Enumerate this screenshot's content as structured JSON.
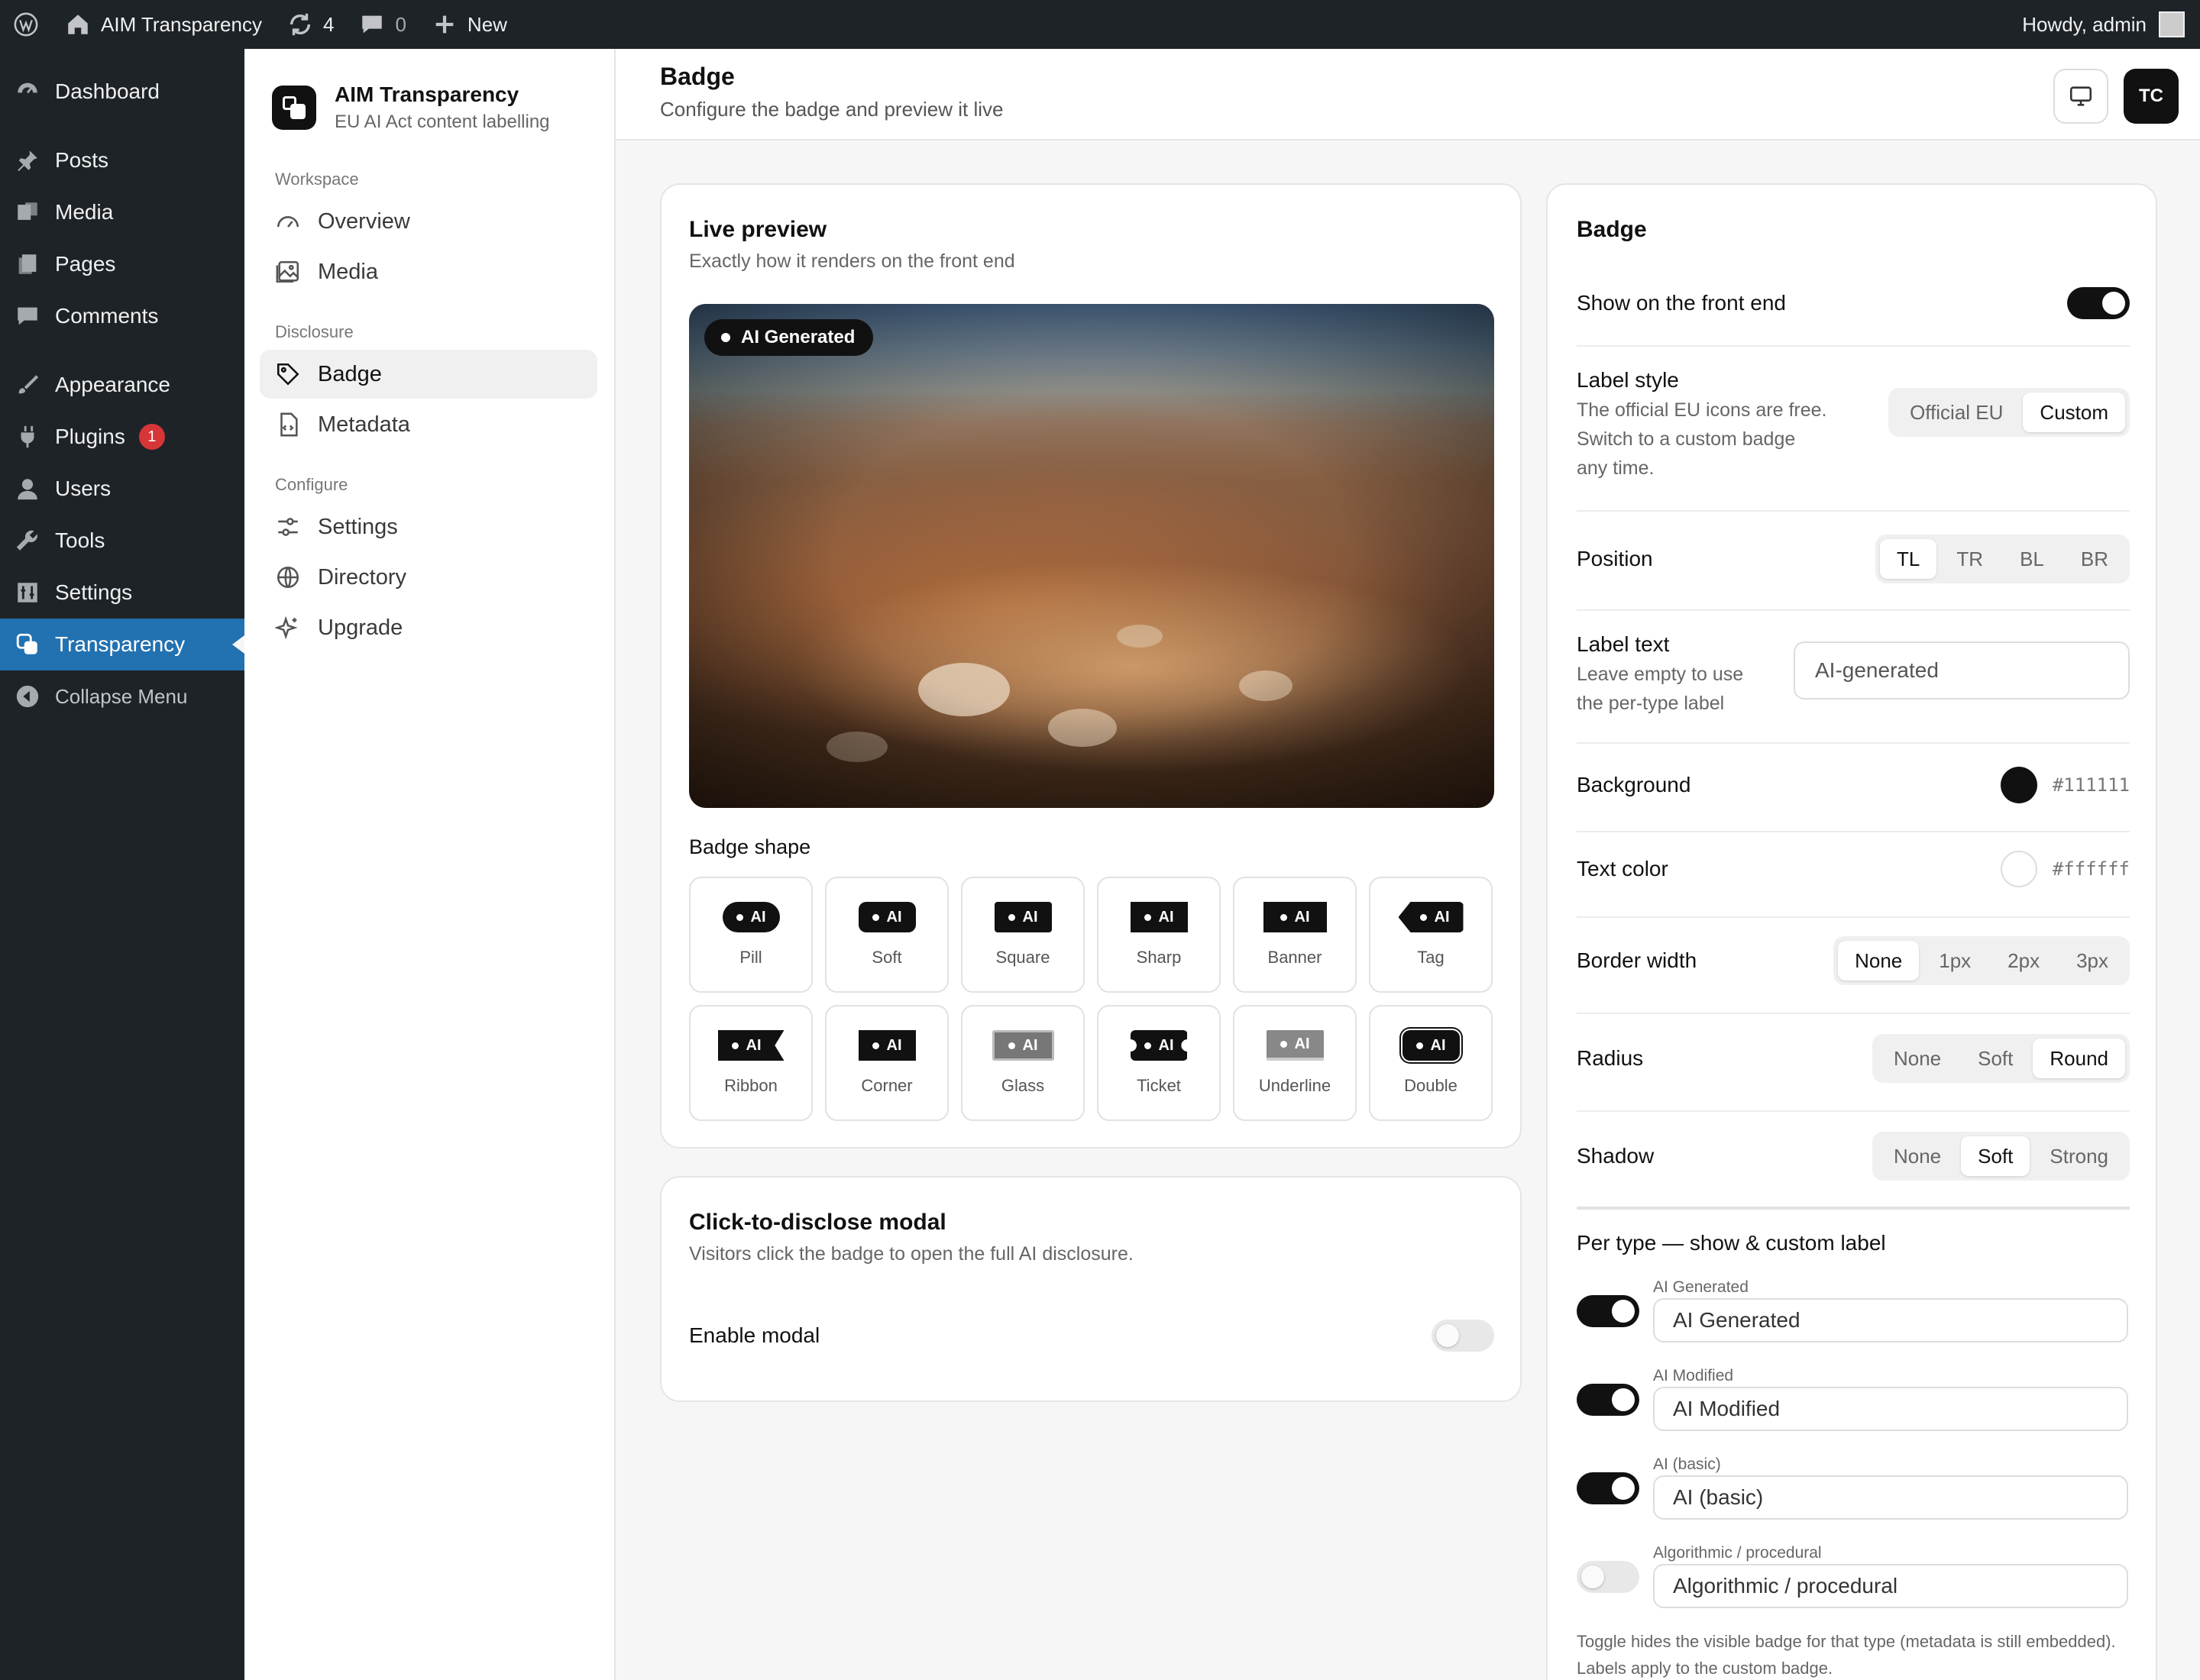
{
  "adminbar": {
    "site_name": "AIM Transparency",
    "updates_count": "4",
    "comments_count": "0",
    "new_label": "New",
    "howdy": "Howdy, admin"
  },
  "wp_menu": {
    "items": [
      {
        "label": "Dashboard",
        "icon": "dashboard-icon"
      },
      {
        "label": "Posts",
        "icon": "pin-icon"
      },
      {
        "label": "Media",
        "icon": "media-icon"
      },
      {
        "label": "Pages",
        "icon": "pages-icon"
      },
      {
        "label": "Comments",
        "icon": "comment-icon"
      },
      {
        "label": "Appearance",
        "icon": "brush-icon"
      },
      {
        "label": "Plugins",
        "icon": "plug-icon",
        "badge": "1"
      },
      {
        "label": "Users",
        "icon": "user-icon"
      },
      {
        "label": "Tools",
        "icon": "wrench-icon"
      },
      {
        "label": "Settings",
        "icon": "settings-icon"
      },
      {
        "label": "Transparency",
        "icon": "transparency-icon",
        "active": true
      },
      {
        "label": "Collapse Menu",
        "icon": "collapse-icon"
      }
    ]
  },
  "plugin_nav": {
    "brand_title": "AIM Transparency",
    "brand_sub": "EU AI Act content labelling",
    "sections": [
      {
        "title": "Workspace",
        "items": [
          {
            "label": "Overview"
          },
          {
            "label": "Media"
          }
        ]
      },
      {
        "title": "Disclosure",
        "items": [
          {
            "label": "Badge",
            "active": true
          },
          {
            "label": "Metadata"
          }
        ]
      },
      {
        "title": "Configure",
        "items": [
          {
            "label": "Settings"
          },
          {
            "label": "Directory"
          },
          {
            "label": "Upgrade"
          }
        ]
      }
    ]
  },
  "header": {
    "title": "Badge",
    "subtitle": "Configure the badge and preview it live",
    "avatar": "TC"
  },
  "preview": {
    "title": "Live preview",
    "subtitle": "Exactly how it renders on the front end",
    "badge_text": "AI Generated",
    "shape_title": "Badge shape",
    "shape_badge_text": "AI",
    "shapes": [
      {
        "label": "Pill",
        "selected": true
      },
      {
        "label": "Soft"
      },
      {
        "label": "Square"
      },
      {
        "label": "Sharp"
      },
      {
        "label": "Banner"
      },
      {
        "label": "Tag"
      },
      {
        "label": "Ribbon"
      },
      {
        "label": "Corner"
      },
      {
        "label": "Glass"
      },
      {
        "label": "Ticket"
      },
      {
        "label": "Underline"
      },
      {
        "label": "Double"
      }
    ]
  },
  "modal": {
    "title": "Click-to-disclose modal",
    "subtitle": "Visitors click the badge to open the full AI disclosure.",
    "enable_label": "Enable modal",
    "enabled": false
  },
  "settings": {
    "title": "Badge",
    "show_front_label": "Show on the front end",
    "show_front": true,
    "label_style": {
      "label": "Label style",
      "help": [
        "The official EU icons are free.",
        "Switch to a custom badge",
        "any time."
      ],
      "options": [
        "Official EU",
        "Custom"
      ],
      "selected": "Custom"
    },
    "position": {
      "label": "Position",
      "options": [
        "TL",
        "TR",
        "BL",
        "BR"
      ],
      "selected": "TL"
    },
    "label_text": {
      "label": "Label text",
      "help": [
        "Leave empty to use",
        "the per-type label"
      ],
      "placeholder": "AI-generated"
    },
    "background": {
      "label": "Background",
      "hex": "#111111"
    },
    "text_color": {
      "label": "Text color",
      "hex": "#ffffff"
    },
    "border_width": {
      "label": "Border width",
      "options": [
        "None",
        "1px",
        "2px",
        "3px"
      ],
      "selected": "None"
    },
    "radius": {
      "label": "Radius",
      "options": [
        "None",
        "Soft",
        "Round"
      ],
      "selected": "Round"
    },
    "shadow": {
      "label": "Shadow",
      "options": [
        "None",
        "Soft",
        "Strong"
      ],
      "selected": "Soft"
    },
    "per_type_title": "Per type — show & custom label",
    "per_type": [
      {
        "type": "AI Generated",
        "value": "AI Generated",
        "enabled": true
      },
      {
        "type": "AI Modified",
        "value": "AI Modified",
        "enabled": true
      },
      {
        "type": "AI (basic)",
        "value": "AI (basic)",
        "enabled": true
      },
      {
        "type": "Algorithmic / procedural",
        "value": "Algorithmic / procedural",
        "enabled": false
      }
    ],
    "footnote": "Toggle hides the visible badge for that type (metadata is still embedded). Labels apply to the custom badge."
  }
}
